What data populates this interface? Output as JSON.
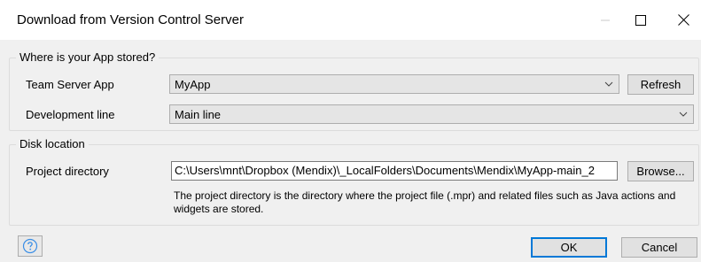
{
  "window": {
    "title": "Download from Version Control Server",
    "controls": [
      "minimize-icon",
      "maximize-icon",
      "close-icon"
    ]
  },
  "app_group": {
    "legend": "Where is your App stored?",
    "team_server_label": "Team Server App",
    "team_server_value": "MyApp",
    "refresh_label": "Refresh",
    "dev_line_label": "Development line",
    "dev_line_value": "Main line"
  },
  "disk_group": {
    "legend": "Disk location",
    "project_dir_label": "Project directory",
    "project_dir_value": "C:\\Users\\mnt\\Dropbox (Mendix)\\_LocalFolders\\Documents\\Mendix\\MyApp-main_2",
    "browse_label": "Browse...",
    "help_text": "The project directory is the directory where the project file (.mpr) and related files such as Java actions and widgets are stored."
  },
  "footer": {
    "help_icon": "question-circle-icon",
    "ok_label": "OK",
    "cancel_label": "Cancel"
  },
  "colors": {
    "accent": "#0078d7",
    "titlebar": "#ffffff",
    "background": "#f0f0f0"
  }
}
